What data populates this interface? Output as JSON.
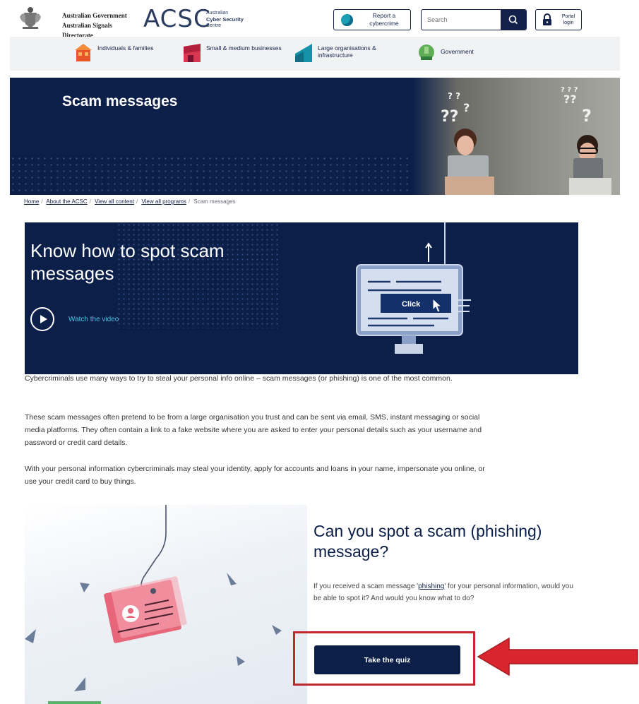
{
  "header": {
    "gov_line1": "Australian Government",
    "gov_line2": "Australian Signals Directorate",
    "acsc_logo": "ACSC",
    "acsc_sub1": "Australian",
    "acsc_sub2": "Cyber Security",
    "acsc_sub3": "Centre",
    "report_label": "Report a cybercrime",
    "search_placeholder": "Search",
    "portal_label": "Portal login"
  },
  "nav": {
    "items": [
      {
        "label": "Individuals & families",
        "icon": "house-icon"
      },
      {
        "label": "Small & medium businesses",
        "icon": "shop-icon"
      },
      {
        "label": "Large organisations & infrastructure",
        "icon": "building-icon"
      },
      {
        "label": "Government",
        "icon": "government-icon"
      }
    ]
  },
  "hero": {
    "title": "Scam messages"
  },
  "breadcrumb": {
    "items": [
      "Home",
      "About the ACSC",
      "View all content",
      "View all programs"
    ],
    "current": "Scam messages"
  },
  "video": {
    "heading": "Know how to spot scam messages",
    "watch_label": "Watch the video",
    "click_label": "Click"
  },
  "body": {
    "p1": "Cybercriminals use many ways to try to steal your personal info online – scam messages (or phishing) is one of the most common.",
    "p2": "These scam messages often pretend to be from a large organisation you trust and can be sent via email, SMS, instant messaging or social media platforms. They often contain a link to a fake website where you are asked to enter your personal details such as your username and password or credit card details.",
    "p3": "With your personal information cybercriminals may steal your identity, apply for accounts and loans in your name, impersonate you online, or use your credit card to buy things."
  },
  "quiz": {
    "heading": "Can you spot a scam (phishing) message?",
    "text_before": "If you received a scam message '",
    "link": "phishing",
    "text_after": "' for your personal information, would you be able to spot it? And would you know what to do?",
    "button_label": "Take the quiz"
  },
  "colors": {
    "navy": "#0b1f49",
    "accent": "#4fc3e6",
    "highlight": "#c1272d"
  }
}
